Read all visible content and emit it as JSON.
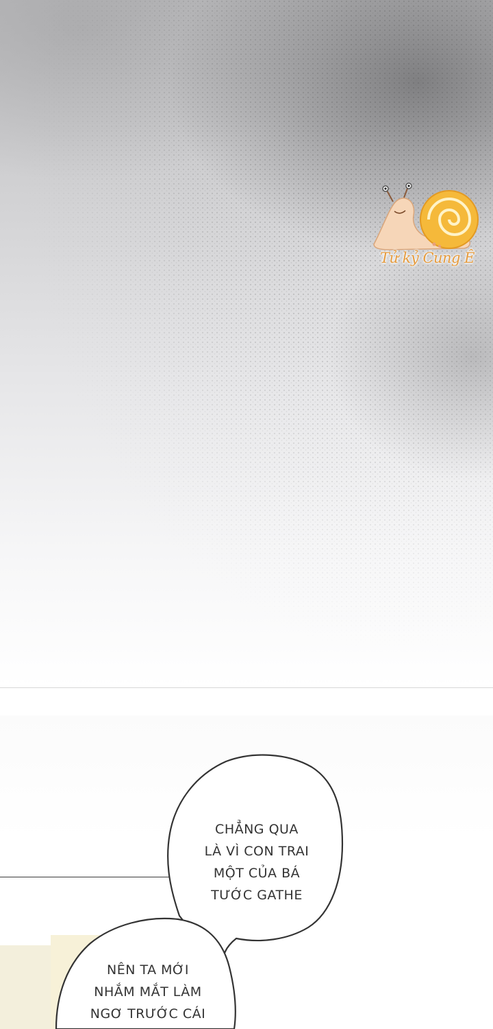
{
  "panel_top": {
    "tone": "grey halftone gradient"
  },
  "watermark": {
    "label": "Tử kỷ Cung Ê",
    "icon": "snail-icon",
    "shell_color": "#f5b93a",
    "body_color": "#f6d6b8"
  },
  "bubble_1": {
    "lines": [
      "CHẲNG QUA",
      "LÀ VÌ CON TRAI",
      "MỘT CỦA BÁ",
      "TƯỚC GATHE"
    ]
  },
  "bubble_2": {
    "lines": [
      "NÊN TA MỚI",
      "NHẮM MẮT LÀM",
      "NGƠ TRƯỚC CÁI"
    ]
  }
}
